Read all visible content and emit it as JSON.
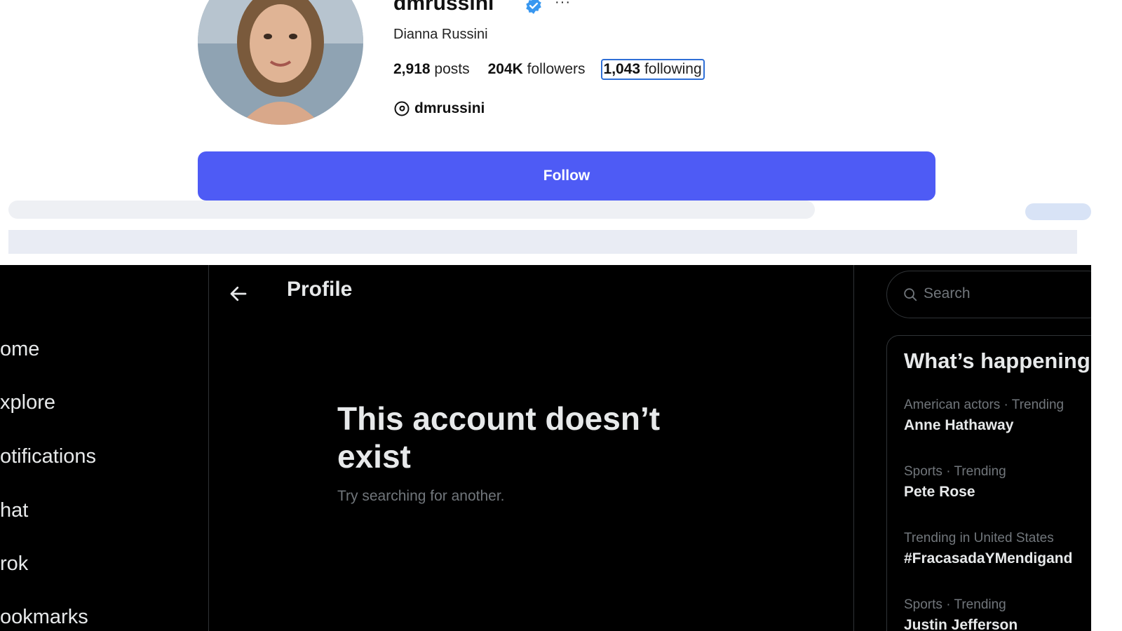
{
  "instagram": {
    "username": "dmrussini",
    "full_name": "Dianna Russini",
    "more_label": "···",
    "stats": {
      "posts_count": "2,918",
      "posts_label": "posts",
      "followers_count": "204K",
      "followers_label": "followers",
      "following_count": "1,043",
      "following_label": "following"
    },
    "threads_handle": "dmrussini",
    "follow_label": "Follow",
    "colors": {
      "follow_button": "#4e5bf5",
      "verified": "#3897f0"
    }
  },
  "x": {
    "nav_items": [
      "ome",
      "xplore",
      "otifications",
      "hat",
      "rok",
      "ookmarks"
    ],
    "header_title": "Profile",
    "error_title": "This account doesn’t exist",
    "error_subtitle": "Try searching for another.",
    "search_placeholder": "Search",
    "happening_title": "What’s happening",
    "trends": [
      {
        "meta": "American actors · Trending",
        "name": "Anne Hathaway"
      },
      {
        "meta": "Sports · Trending",
        "name": "Pete Rose"
      },
      {
        "meta": "Trending in United States",
        "name": "#FracasadaYMendigand"
      },
      {
        "meta": "Sports · Trending",
        "name": "Justin Jefferson"
      }
    ]
  }
}
